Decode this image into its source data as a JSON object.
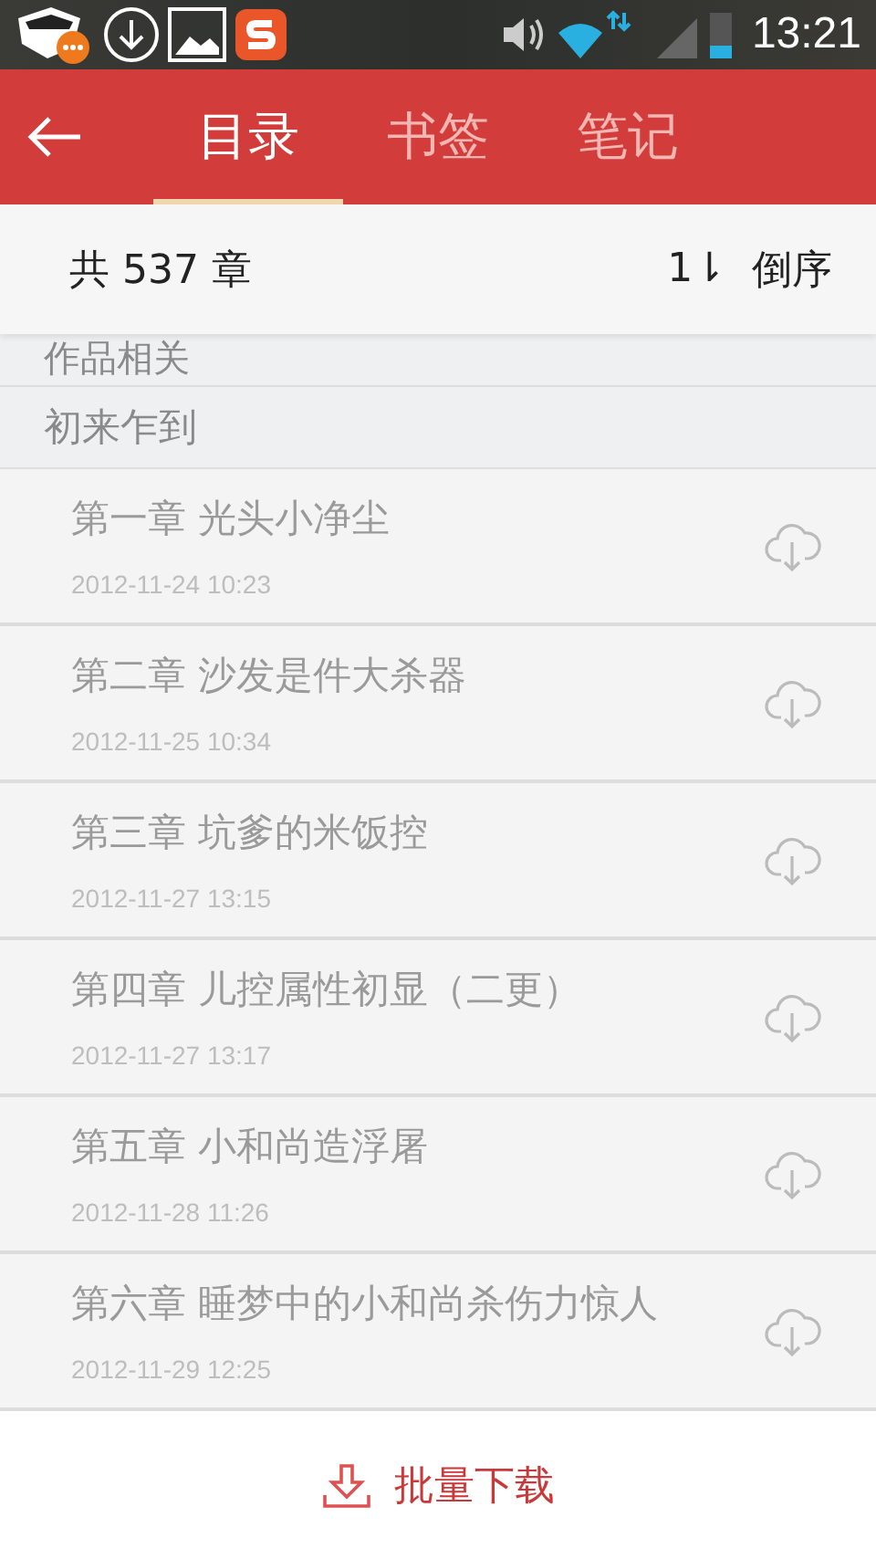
{
  "status_bar": {
    "time": "13:21"
  },
  "header": {
    "tabs": [
      {
        "label": "目录",
        "selected": true
      },
      {
        "label": "书签",
        "selected": false
      },
      {
        "label": "笔记",
        "selected": false
      }
    ]
  },
  "summary": {
    "count": "共 537 章",
    "sort_icon": "1⇂",
    "sort_label": "倒序"
  },
  "sections": [
    {
      "title": "作品相关"
    },
    {
      "title": "初来乍到",
      "chapters": [
        {
          "title": "第一章 光头小净尘",
          "date": "2012-11-24 10:23"
        },
        {
          "title": "第二章 沙发是件大杀器",
          "date": "2012-11-25 10:34"
        },
        {
          "title": "第三章 坑爹的米饭控",
          "date": "2012-11-27 13:15"
        },
        {
          "title": "第四章 儿控属性初显（二更）",
          "date": "2012-11-27 13:17"
        },
        {
          "title": "第五章 小和尚造浮屠",
          "date": "2012-11-28 11:26"
        },
        {
          "title": "第六章 睡梦中的小和尚杀伤力惊人",
          "date": "2012-11-29 12:25"
        }
      ]
    }
  ],
  "bottom": {
    "label": "批量下载"
  }
}
